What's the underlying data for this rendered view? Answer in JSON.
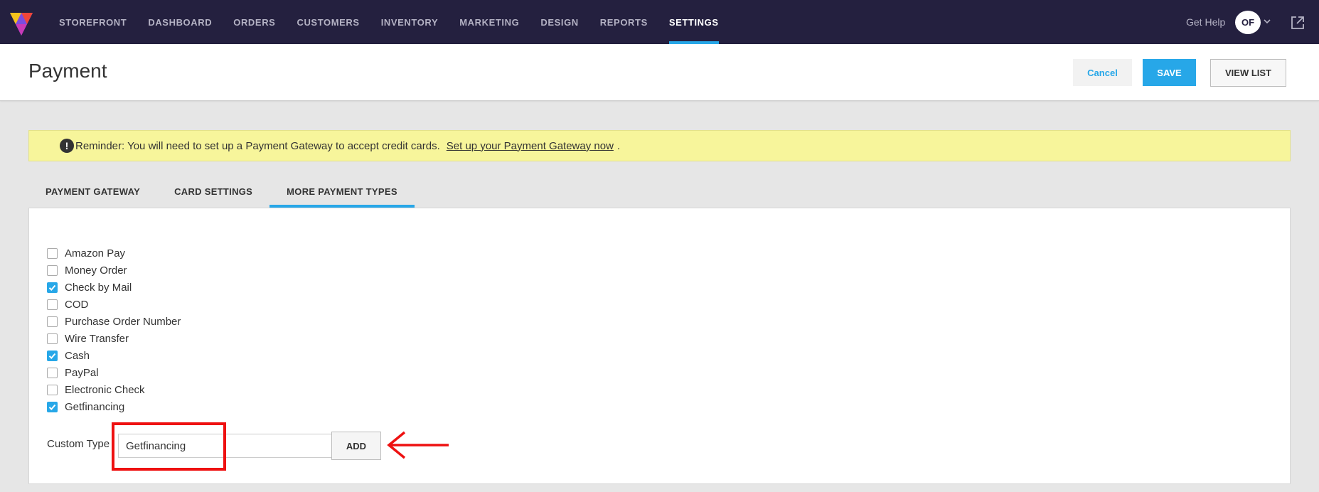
{
  "nav": {
    "items": [
      {
        "label": "STOREFRONT",
        "active": false
      },
      {
        "label": "DASHBOARD",
        "active": false
      },
      {
        "label": "ORDERS",
        "active": false
      },
      {
        "label": "CUSTOMERS",
        "active": false
      },
      {
        "label": "INVENTORY",
        "active": false
      },
      {
        "label": "MARKETING",
        "active": false
      },
      {
        "label": "DESIGN",
        "active": false
      },
      {
        "label": "REPORTS",
        "active": false
      },
      {
        "label": "SETTINGS",
        "active": true
      }
    ],
    "get_help": "Get Help",
    "avatar_initials": "OF"
  },
  "header": {
    "title": "Payment",
    "cancel_label": "Cancel",
    "save_label": "SAVE",
    "view_list_label": "VIEW LIST"
  },
  "reminder": {
    "icon": "!",
    "text": "Reminder: You will need to set up a Payment Gateway to accept credit cards.",
    "link_text": "Set up your Payment Gateway now",
    "end": "."
  },
  "tabs": [
    {
      "label": "PAYMENT GATEWAY",
      "active": false
    },
    {
      "label": "CARD SETTINGS",
      "active": false
    },
    {
      "label": "MORE PAYMENT TYPES",
      "active": true
    }
  ],
  "payment_types": [
    {
      "label": "Amazon Pay",
      "checked": false
    },
    {
      "label": "Money Order",
      "checked": false
    },
    {
      "label": "Check by Mail",
      "checked": true
    },
    {
      "label": "COD",
      "checked": false
    },
    {
      "label": "Purchase Order Number",
      "checked": false
    },
    {
      "label": "Wire Transfer",
      "checked": false
    },
    {
      "label": "Cash",
      "checked": true
    },
    {
      "label": "PayPal",
      "checked": false
    },
    {
      "label": "Electronic Check",
      "checked": false
    },
    {
      "label": "Getfinancing",
      "checked": true
    }
  ],
  "custom_type": {
    "label": "Custom Type",
    "value": "Getfinancing",
    "add_label": "ADD"
  },
  "colors": {
    "nav_bg": "#24203f",
    "accent": "#27a7e8",
    "reminder_bg": "#f7f59b",
    "annotation": "#ee1111"
  }
}
